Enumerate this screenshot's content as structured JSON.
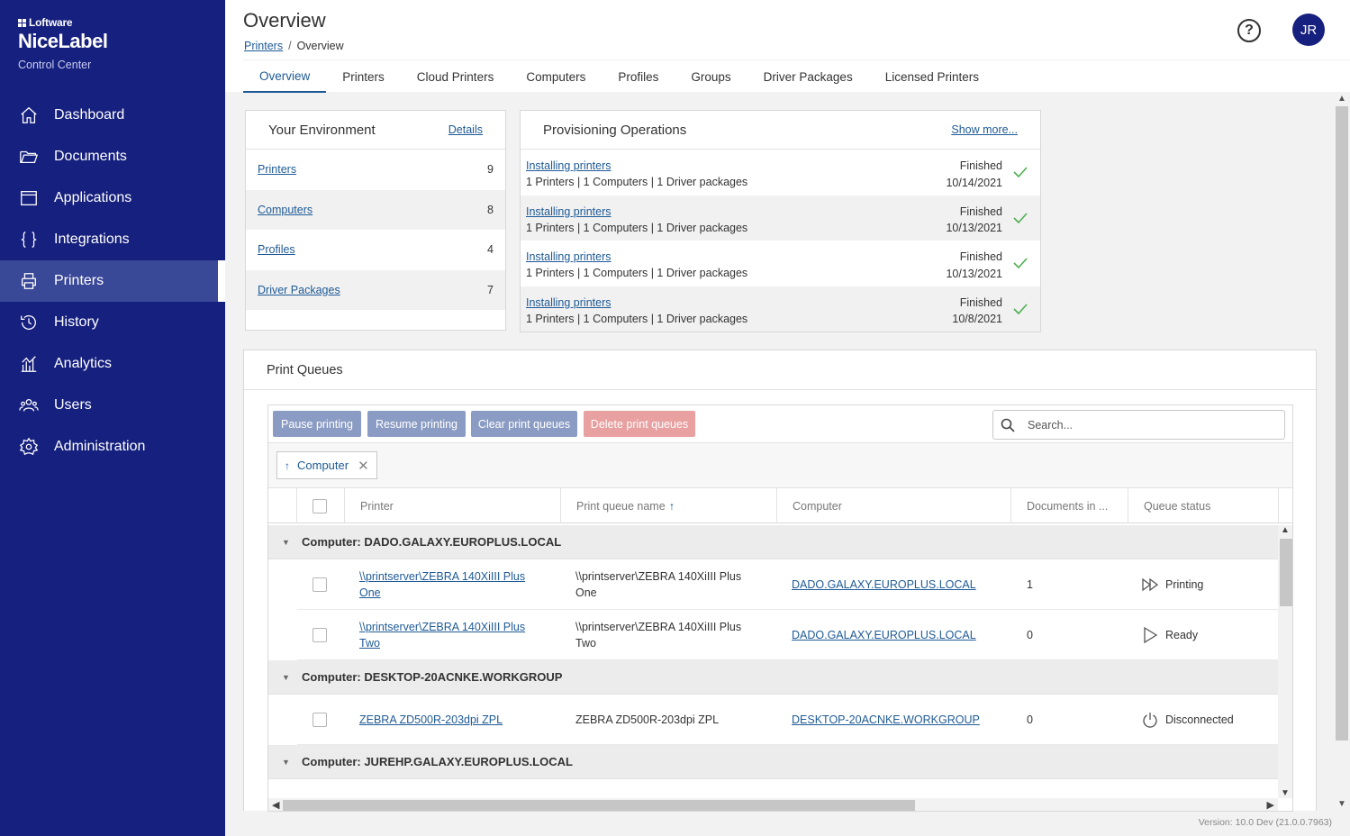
{
  "sidebar": {
    "brand": {
      "company": "Loftware",
      "product": "NiceLabel",
      "subtitle": "Control Center"
    },
    "items": [
      {
        "label": "Dashboard",
        "icon": "home-icon"
      },
      {
        "label": "Documents",
        "icon": "folder-icon"
      },
      {
        "label": "Applications",
        "icon": "window-icon"
      },
      {
        "label": "Integrations",
        "icon": "braces-icon"
      },
      {
        "label": "Printers",
        "icon": "printer-icon",
        "active": true
      },
      {
        "label": "History",
        "icon": "history-icon"
      },
      {
        "label": "Analytics",
        "icon": "analytics-icon"
      },
      {
        "label": "Users",
        "icon": "users-icon"
      },
      {
        "label": "Administration",
        "icon": "gear-icon"
      }
    ]
  },
  "header": {
    "title": "Overview",
    "breadcrumb": {
      "parent": "Printers",
      "separator": "/",
      "current": "Overview"
    },
    "help": "?",
    "avatar": "JR",
    "tabs": [
      "Overview",
      "Printers",
      "Cloud Printers",
      "Computers",
      "Profiles",
      "Groups",
      "Driver Packages",
      "Licensed Printers"
    ],
    "active_tab": "Overview"
  },
  "environment": {
    "title": "Your Environment",
    "details_link": "Details",
    "rows": [
      {
        "label": "Printers",
        "count": "9"
      },
      {
        "label": "Computers",
        "count": "8"
      },
      {
        "label": "Profiles",
        "count": "4"
      },
      {
        "label": "Driver Packages",
        "count": "7"
      }
    ]
  },
  "provisioning": {
    "title": "Provisioning Operations",
    "more_link": "Show more...",
    "rows": [
      {
        "op": "Installing printers",
        "detail": "1 Printers | 1 Computers | 1 Driver packages",
        "status": "Finished",
        "date": "10/14/2021"
      },
      {
        "op": "Installing printers",
        "detail": "1 Printers | 1 Computers | 1 Driver packages",
        "status": "Finished",
        "date": "10/13/2021"
      },
      {
        "op": "Installing printers",
        "detail": "1 Printers | 1 Computers | 1 Driver packages",
        "status": "Finished",
        "date": "10/13/2021"
      },
      {
        "op": "Installing printers",
        "detail": "1 Printers | 1 Computers | 1 Driver packages",
        "status": "Finished",
        "date": "10/8/2021"
      }
    ],
    "check_color": "#4caf50"
  },
  "print_queues": {
    "title": "Print Queues",
    "buttons": {
      "pause": "Pause printing",
      "resume": "Resume printing",
      "clear": "Clear print queues",
      "delete": "Delete print queues"
    },
    "search_placeholder": "Search...",
    "group_chip": "Computer",
    "columns": {
      "printer": "Printer",
      "queue_name": "Print queue name",
      "computer": "Computer",
      "documents": "Documents in ...",
      "status": "Queue status"
    },
    "groups": [
      {
        "label": "Computer: DADO.GALAXY.EUROPLUS.LOCAL",
        "rows": [
          {
            "printer_l1": "\\\\printserver\\ZEBRA 140XiIII Plus",
            "printer_l2": "One",
            "queue_l1": "\\\\printserver\\ZEBRA 140XiIII Plus",
            "queue_l2": "One",
            "computer": "DADO.GALAXY.EUROPLUS.LOCAL",
            "documents": "1",
            "status": "Printing",
            "status_icon": "fast-forward-icon"
          },
          {
            "printer_l1": "\\\\printserver\\ZEBRA 140XiIII Plus",
            "printer_l2": "Two",
            "queue_l1": "\\\\printserver\\ZEBRA 140XiIII Plus",
            "queue_l2": "Two",
            "computer": "DADO.GALAXY.EUROPLUS.LOCAL",
            "documents": "0",
            "status": "Ready",
            "status_icon": "play-icon"
          }
        ]
      },
      {
        "label": "Computer: DESKTOP-20ACNKE.WORKGROUP",
        "rows": [
          {
            "printer_l1": "ZEBRA ZD500R-203dpi ZPL",
            "printer_l2": "",
            "queue_l1": "ZEBRA ZD500R-203dpi ZPL",
            "queue_l2": "",
            "computer": "DESKTOP-20ACNKE.WORKGROUP",
            "documents": "0",
            "status": "Disconnected",
            "status_icon": "power-icon"
          }
        ]
      },
      {
        "label": "Computer: JUREHP.GALAXY.EUROPLUS.LOCAL",
        "rows": []
      }
    ]
  },
  "version": "Version: 10.0 Dev (21.0.0.7963)",
  "colors": {
    "sidebar": "#16207e",
    "link": "#1e5a96",
    "accent_button": "#8b9cc4",
    "danger_button": "#e8a0a0"
  }
}
